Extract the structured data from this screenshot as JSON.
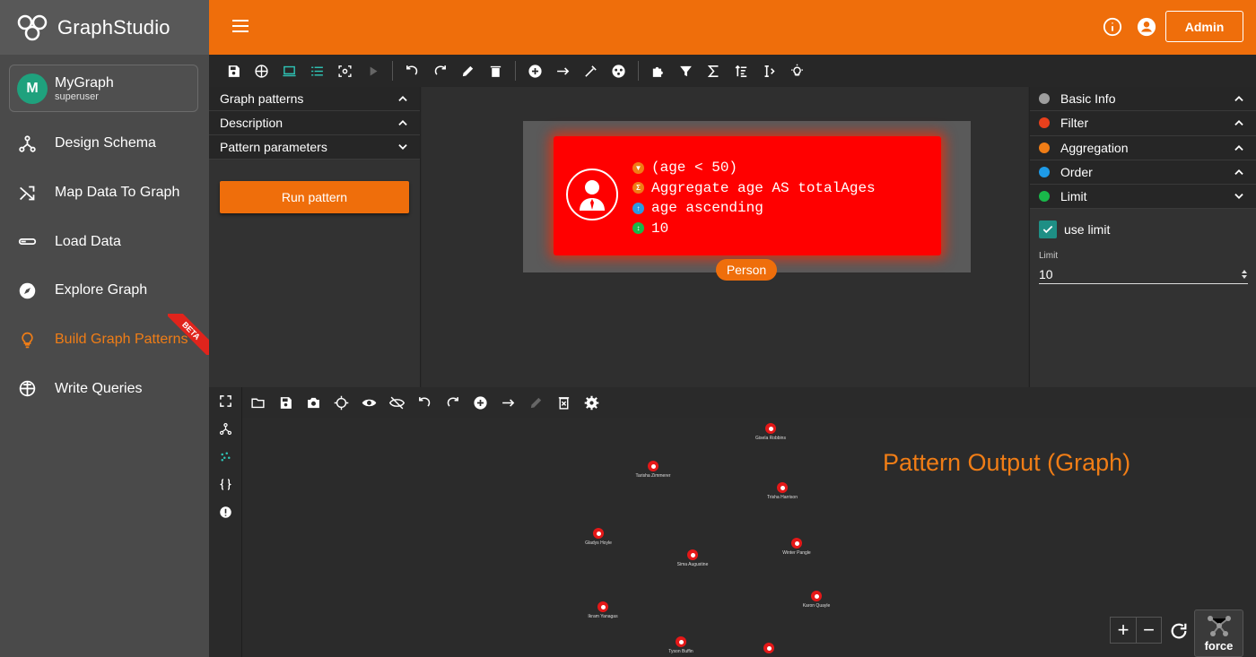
{
  "app": {
    "logo_graph": "Graph",
    "logo_studio": "Studio"
  },
  "graph_card": {
    "avatar_letter": "M",
    "name": "MyGraph",
    "user": "superuser"
  },
  "sidebar": {
    "items": [
      {
        "label": "Design Schema",
        "icon": "schema-icon"
      },
      {
        "label": "Map Data To Graph",
        "icon": "shuffle-icon"
      },
      {
        "label": "Load Data",
        "icon": "load-data-icon"
      },
      {
        "label": "Explore Graph",
        "icon": "compass-icon"
      },
      {
        "label": "Build Graph Patterns",
        "icon": "lightbulb-icon",
        "active": true,
        "badge": "BETA"
      },
      {
        "label": "Write Queries",
        "icon": "globe-query-icon"
      }
    ]
  },
  "topbar": {
    "admin_label": "Admin"
  },
  "left_panel": {
    "sections": [
      {
        "label": "Graph patterns",
        "state": "expanded"
      },
      {
        "label": "Description",
        "state": "expanded"
      },
      {
        "label": "Pattern parameters",
        "state": "collapsed"
      }
    ],
    "run_button": "Run pattern"
  },
  "pattern_node": {
    "lines": [
      {
        "icon": "filter-icon",
        "color": "#f07d16",
        "glyph": "▼",
        "text": "(age < 50)"
      },
      {
        "icon": "sigma-icon",
        "color": "#f07d16",
        "glyph": "Σ",
        "text": "Aggregate age AS totalAges"
      },
      {
        "icon": "sort-icon",
        "color": "#2b9be0",
        "glyph": "↑",
        "text": "age ascending"
      },
      {
        "icon": "limit-icon",
        "color": "#19b84a",
        "glyph": "↕",
        "text": "10"
      }
    ],
    "label": "Person"
  },
  "right_panel": {
    "sections": [
      {
        "label": "Basic Info",
        "dot_color": "#9e9e9e",
        "state": "expanded"
      },
      {
        "label": "Filter",
        "dot_color": "#e8401c",
        "state": "expanded"
      },
      {
        "label": "Aggregation",
        "dot_color": "#f07d16",
        "state": "expanded"
      },
      {
        "label": "Order",
        "dot_color": "#1e9be8",
        "state": "expanded"
      },
      {
        "label": "Limit",
        "dot_color": "#19b84a",
        "state": "collapsed"
      }
    ],
    "use_limit_label": "use limit",
    "use_limit_checked": true,
    "limit_label": "Limit",
    "limit_value": "10"
  },
  "graph_output": {
    "title": "Pattern Output (Graph)",
    "force_label": "force",
    "nodes": [
      {
        "name": "Gisela Robbins"
      },
      {
        "name": "Tarisha Zimmerer"
      },
      {
        "name": "Trisha Harrison"
      },
      {
        "name": "Gladys Hoyle"
      },
      {
        "name": "Winter Pangle"
      },
      {
        "name": "Sima Augustine"
      },
      {
        "name": "Karon Quayle"
      },
      {
        "name": "Ikram Yanagas"
      },
      {
        "name": "Tyson Buffin"
      },
      {
        "name": ""
      }
    ]
  },
  "colors": {
    "accent": "#ef6e0b",
    "node_red": "#ff0000",
    "teal": "#1e8f85"
  }
}
